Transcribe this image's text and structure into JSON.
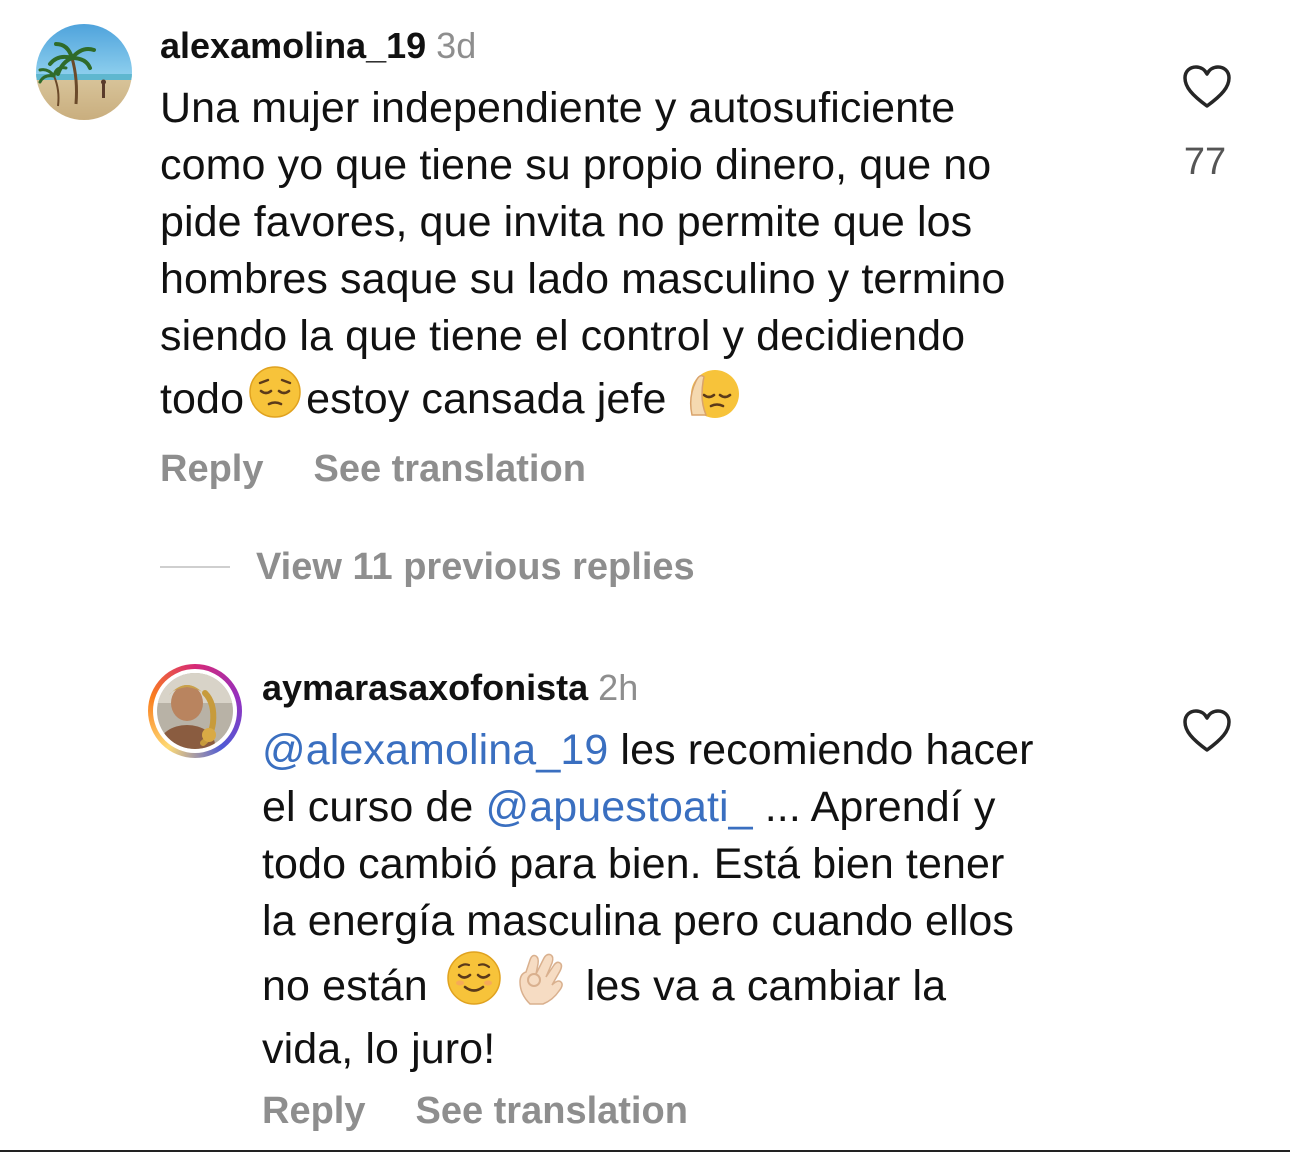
{
  "comment": {
    "username": "alexamolina_19",
    "time": "3d",
    "lines": [
      "Una mujer independiente y autosuficiente",
      "como yo que tiene su propio dinero, que no",
      "pide favores, que invita no permite que los",
      "hombres saque su lado masculino y termino",
      "siendo la que tiene el control y decidiendo"
    ],
    "last_line_start": "todo",
    "last_line_mid": "estoy cansada jefe",
    "like_count": "77",
    "reply_label": "Reply",
    "translate_label": "See translation",
    "icons": [
      "pensive-emoji",
      "pensive-emoji-with-hand"
    ]
  },
  "view_replies": {
    "label": "View 11 previous replies"
  },
  "reply": {
    "username": "aymarasaxofonista",
    "time": "2h",
    "mention1": "@alexamolina_19",
    "line1_rest": " les recomiendo hacer",
    "line2_start": "el curso de ",
    "mention2": "@apuestoati_",
    "line2_rest": " ... Aprendí y",
    "line3": "todo cambió para bien. Está bien tener",
    "line4": "la energía masculina pero cuando ellos",
    "line5_start": "no están",
    "line5_end": "les va a cambiar la",
    "line6": "vida, lo juro!",
    "reply_label": "Reply",
    "translate_label": "See translation",
    "icons": [
      "relieved-emoji",
      "ok-hand-emoji"
    ]
  },
  "colors": {
    "mention": "#3a6fc0",
    "muted": "#8e8e8e",
    "text": "#111111"
  }
}
